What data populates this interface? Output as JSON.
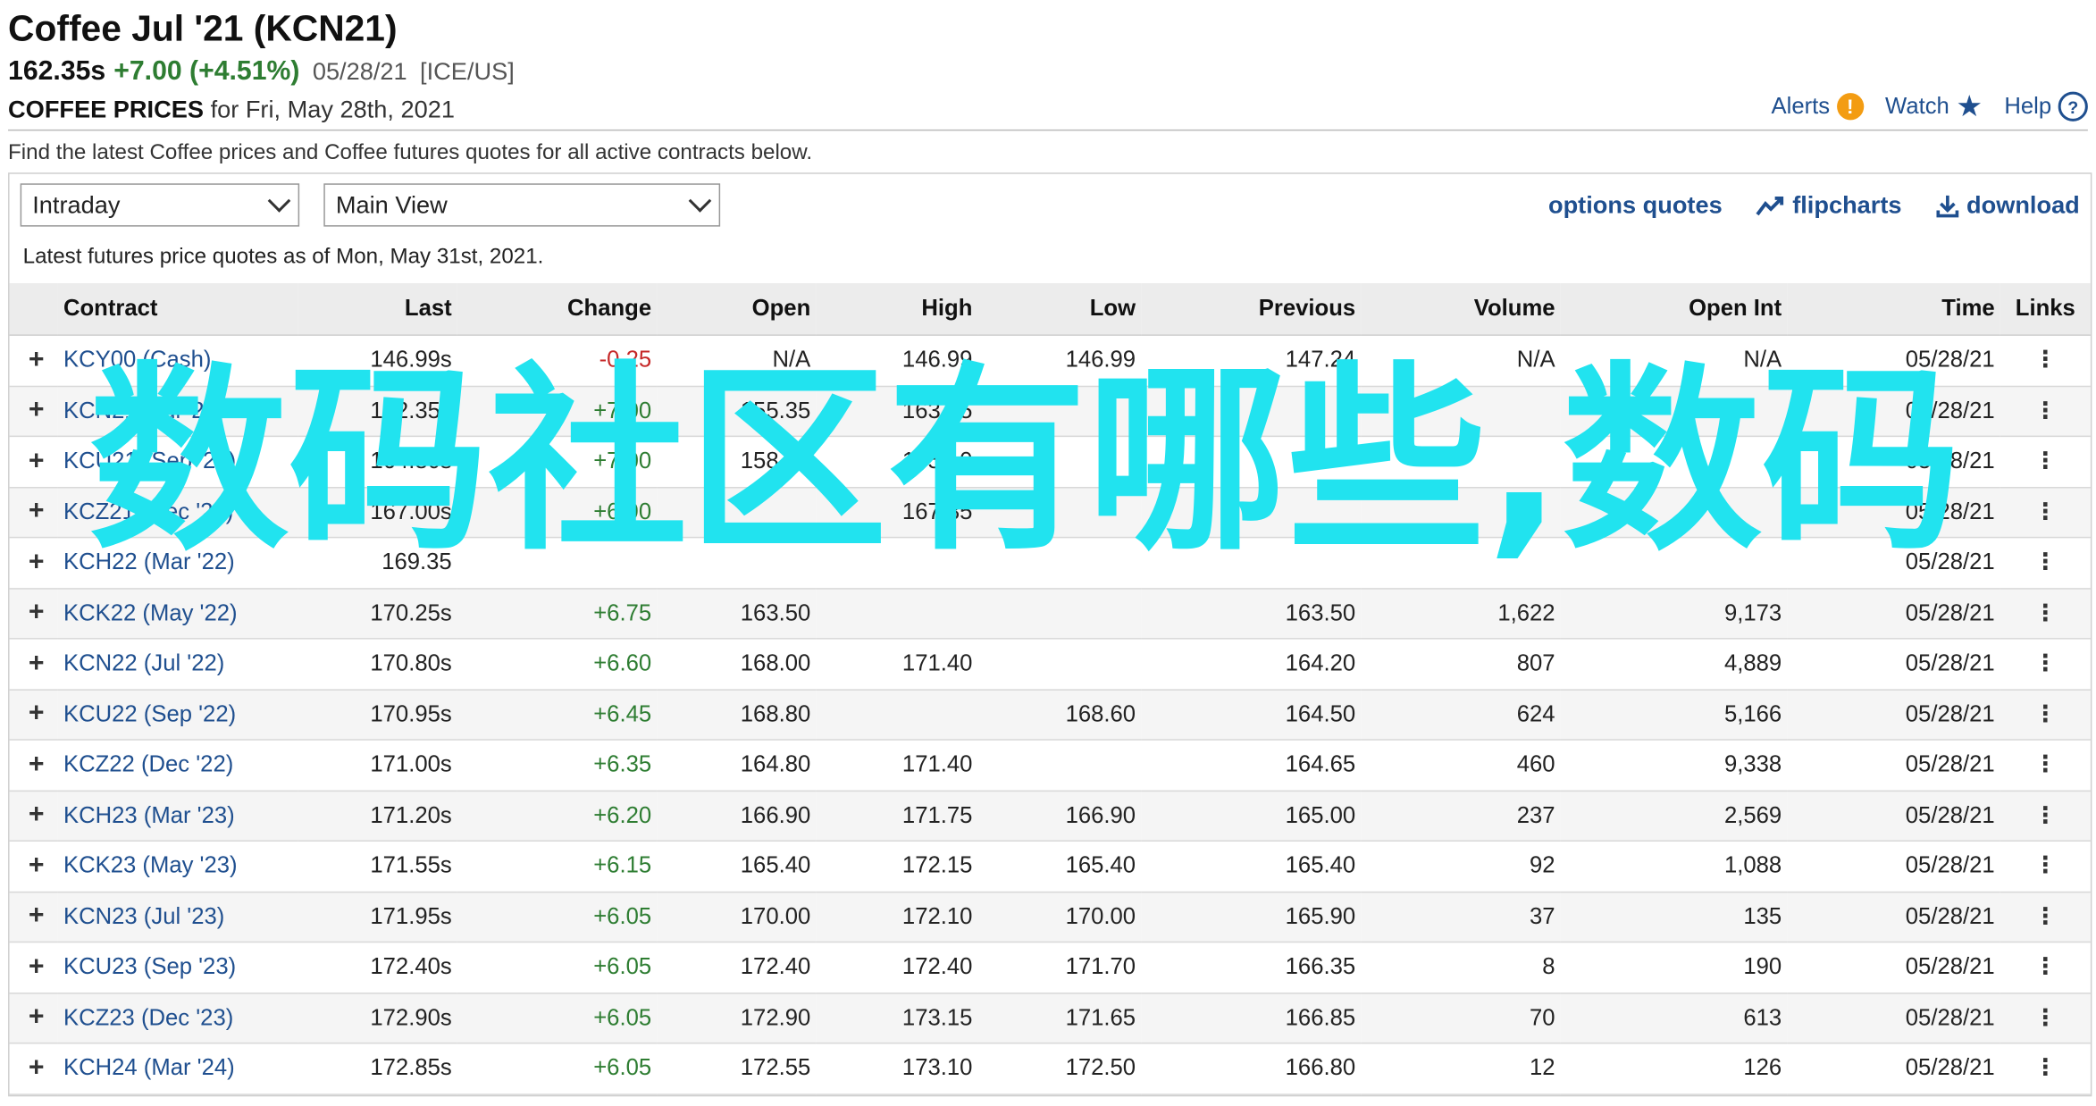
{
  "header": {
    "title": "Coffee Jul '21 (KCN21)",
    "last": "162.35s",
    "change": "+7.00 (+4.51%)",
    "date": "05/28/21",
    "exchange": "[ICE/US]",
    "subtitle_bold": "COFFEE PRICES",
    "subtitle_rest": "for Fri, May 28th, 2021",
    "alerts": "Alerts",
    "watch": "Watch",
    "help": "Help"
  },
  "intro": "Find the latest Coffee prices and Coffee futures quotes for all active contracts below.",
  "controls": {
    "period": "Intraday",
    "view": "Main View",
    "options_quotes": "options quotes",
    "flipcharts": "flipcharts",
    "download": "download"
  },
  "asof": "Latest futures price quotes as of Mon, May 31st, 2021.",
  "columns": [
    "Contract",
    "Last",
    "Change",
    "Open",
    "High",
    "Low",
    "Previous",
    "Volume",
    "Open Int",
    "Time",
    "Links"
  ],
  "rows": [
    {
      "contract": "KCY00 (Cash)",
      "last": "146.99s",
      "change": "-0.25",
      "open": "N/A",
      "high": "146.99",
      "low": "146.99",
      "previous": "147.24",
      "volume": "N/A",
      "oi": "N/A",
      "time": "05/28/21"
    },
    {
      "contract": "KCN21 (Jul '21)",
      "last": "162.35s",
      "change": "+7.00",
      "open": "155.35",
      "high": "163.15",
      "low": "",
      "previous": "",
      "volume": "",
      "oi": "",
      "time": "05/28/21"
    },
    {
      "contract": "KCU21 (Sep '21)",
      "last": "164.80s",
      "change": "+7.00",
      "open": "158.25",
      "high": "165.10",
      "low": "",
      "previous": "",
      "volume": "",
      "oi": "",
      "time": "05/28/21"
    },
    {
      "contract": "KCZ21 (Dec '21)",
      "last": "167.00s",
      "change": "+6.90",
      "open": "",
      "high": "167.85",
      "low": "",
      "previous": "",
      "volume": "",
      "oi": "",
      "time": "05/28/21"
    },
    {
      "contract": "KCH22 (Mar '22)",
      "last": "169.35",
      "change": "",
      "open": "",
      "high": "",
      "low": "",
      "previous": "",
      "volume": "",
      "oi": "",
      "time": "05/28/21"
    },
    {
      "contract": "KCK22 (May '22)",
      "last": "170.25s",
      "change": "+6.75",
      "open": "163.50",
      "high": "",
      "low": "",
      "previous": "163.50",
      "volume": "1,622",
      "oi": "9,173",
      "time": "05/28/21"
    },
    {
      "contract": "KCN22 (Jul '22)",
      "last": "170.80s",
      "change": "+6.60",
      "open": "168.00",
      "high": "171.40",
      "low": "",
      "previous": "164.20",
      "volume": "807",
      "oi": "4,889",
      "time": "05/28/21"
    },
    {
      "contract": "KCU22 (Sep '22)",
      "last": "170.95s",
      "change": "+6.45",
      "open": "168.80",
      "high": "",
      "low": "168.60",
      "previous": "164.50",
      "volume": "624",
      "oi": "5,166",
      "time": "05/28/21"
    },
    {
      "contract": "KCZ22 (Dec '22)",
      "last": "171.00s",
      "change": "+6.35",
      "open": "164.80",
      "high": "171.40",
      "low": "",
      "previous": "164.65",
      "volume": "460",
      "oi": "9,338",
      "time": "05/28/21"
    },
    {
      "contract": "KCH23 (Mar '23)",
      "last": "171.20s",
      "change": "+6.20",
      "open": "166.90",
      "high": "171.75",
      "low": "166.90",
      "previous": "165.00",
      "volume": "237",
      "oi": "2,569",
      "time": "05/28/21"
    },
    {
      "contract": "KCK23 (May '23)",
      "last": "171.55s",
      "change": "+6.15",
      "open": "165.40",
      "high": "172.15",
      "low": "165.40",
      "previous": "165.40",
      "volume": "92",
      "oi": "1,088",
      "time": "05/28/21"
    },
    {
      "contract": "KCN23 (Jul '23)",
      "last": "171.95s",
      "change": "+6.05",
      "open": "170.00",
      "high": "172.10",
      "low": "170.00",
      "previous": "165.90",
      "volume": "37",
      "oi": "135",
      "time": "05/28/21"
    },
    {
      "contract": "KCU23 (Sep '23)",
      "last": "172.40s",
      "change": "+6.05",
      "open": "172.40",
      "high": "172.40",
      "low": "171.70",
      "previous": "166.35",
      "volume": "8",
      "oi": "190",
      "time": "05/28/21"
    },
    {
      "contract": "KCZ23 (Dec '23)",
      "last": "172.90s",
      "change": "+6.05",
      "open": "172.90",
      "high": "173.15",
      "low": "171.65",
      "previous": "166.85",
      "volume": "70",
      "oi": "613",
      "time": "05/28/21"
    },
    {
      "contract": "KCH24 (Mar '24)",
      "last": "172.85s",
      "change": "+6.05",
      "open": "172.55",
      "high": "173.10",
      "low": "172.50",
      "previous": "166.80",
      "volume": "12",
      "oi": "126",
      "time": "05/28/21"
    }
  ],
  "watermark": "数码社区有哪些,数码"
}
